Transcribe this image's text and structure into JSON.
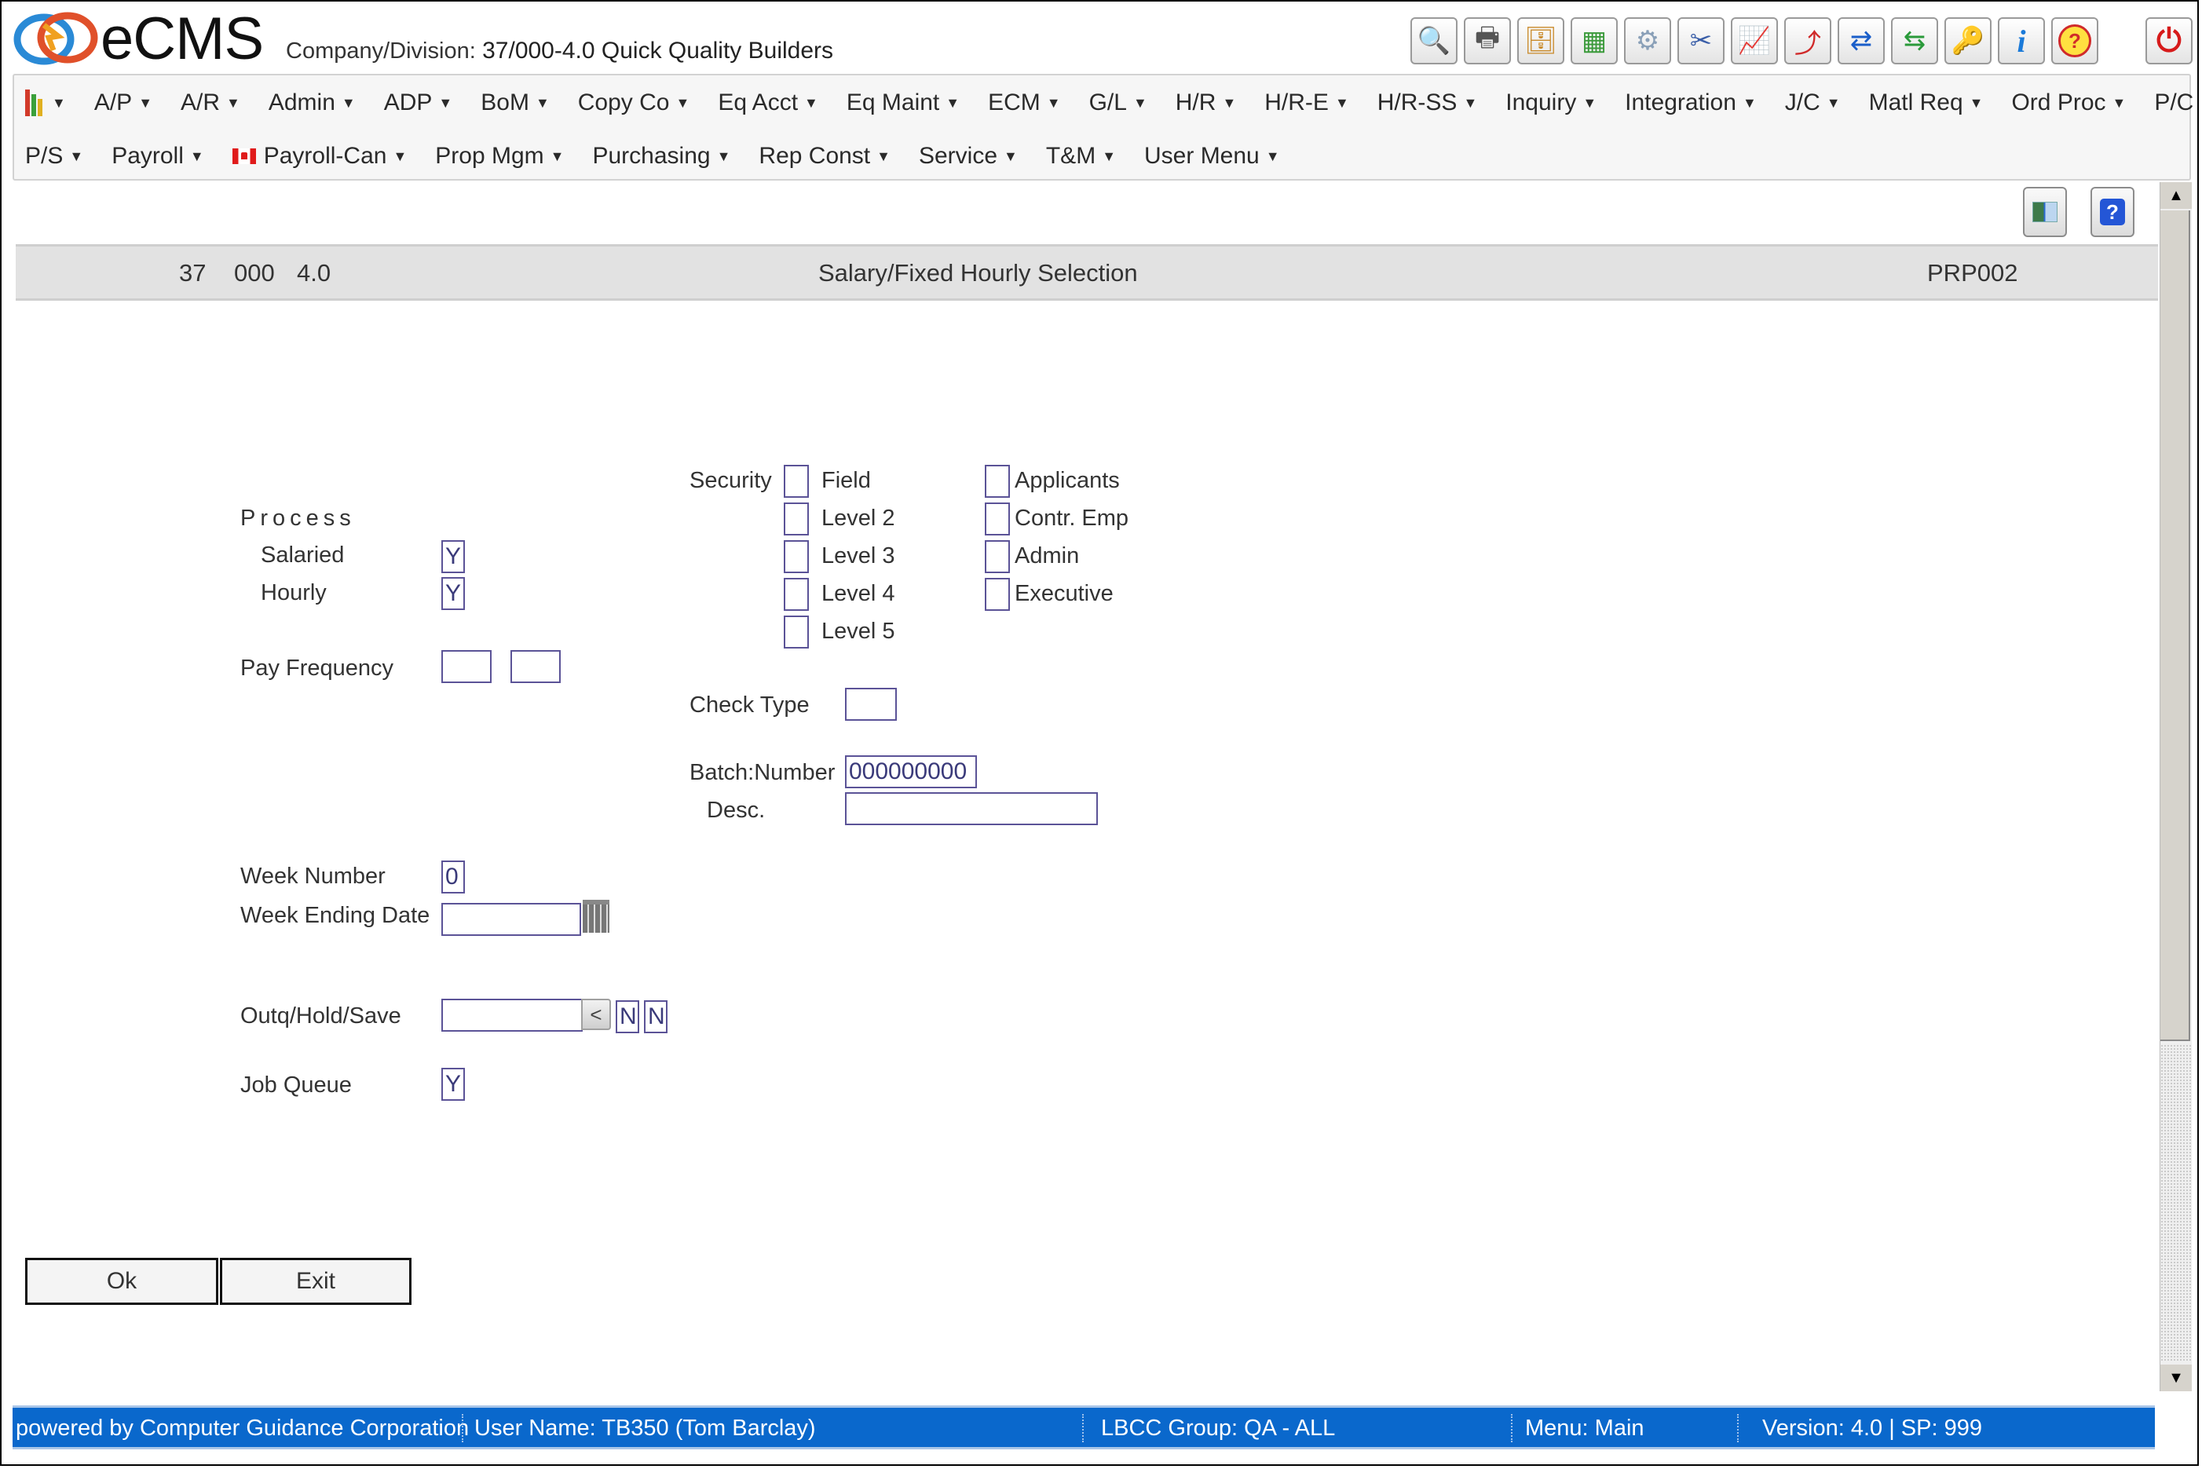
{
  "app": {
    "brand": "eCMS",
    "company_label": "Company/Division:",
    "company_value": "37/000-4.0 Quick Quality Builders"
  },
  "toolbar": {
    "icons": [
      {
        "name": "web-search-icon",
        "glyph": "🔍",
        "color": "#1a6fc9"
      },
      {
        "name": "printer-icon",
        "glyph": "🖶",
        "color": "#555555"
      },
      {
        "name": "file-cabinet-icon",
        "glyph": "🗄",
        "color": "#c98a2a"
      },
      {
        "name": "spreadsheet-icon",
        "glyph": "▦",
        "color": "#3a9a3a"
      },
      {
        "name": "gear-icon",
        "glyph": "⚙",
        "color": "#8aa0b8"
      },
      {
        "name": "tools-icon",
        "glyph": "✂",
        "color": "#3a5ea8"
      },
      {
        "name": "trend-up-icon",
        "glyph": "📈",
        "color": "#d02a2a"
      },
      {
        "name": "trend-compare-icon",
        "glyph": "⤴",
        "color": "#d02a2a"
      },
      {
        "name": "refresh-icon",
        "glyph": "⇄",
        "color": "#1a5ec9"
      },
      {
        "name": "window-transfer-icon",
        "glyph": "⇆",
        "color": "#2a9a3a"
      },
      {
        "name": "keys-icon",
        "glyph": "🔑",
        "color": "#c99a2a"
      },
      {
        "name": "info-icon",
        "glyph": "i",
        "color": "#1a7ad9"
      },
      {
        "name": "help-icon",
        "glyph": "?",
        "color": "#d02a2a"
      }
    ],
    "power": {
      "name": "power-icon",
      "glyph": "⏻",
      "color": "#d61a1a"
    }
  },
  "menu": {
    "row1": [
      "A/P",
      "A/R",
      "Admin",
      "ADP",
      "BoM",
      "Copy Co",
      "Eq Acct",
      "Eq Maint",
      "ECM",
      "G/L",
      "H/R",
      "H/R-E",
      "H/R-SS",
      "Inquiry",
      "Integration",
      "J/C",
      "Matl Req",
      "Ord Proc",
      "P/C"
    ],
    "row2_start": [
      "P/S",
      "Payroll"
    ],
    "payroll_can": "Payroll-Can",
    "row2_end": [
      "Prop Mgm",
      "Purchasing",
      "Rep Const",
      "Service",
      "T&M",
      "User Menu"
    ],
    "arrow": "▼"
  },
  "page": {
    "company": "37",
    "division": "000",
    "version": "4.0",
    "title": "Salary/Fixed Hourly Selection",
    "program": "PRP002"
  },
  "form": {
    "process_label": "Process",
    "salaried": {
      "label": "Salaried",
      "value": "Y"
    },
    "hourly": {
      "label": "Hourly",
      "value": "Y"
    },
    "pay_frequency": {
      "label": "Pay Frequency",
      "value1": "",
      "value2": ""
    },
    "security": {
      "label": "Security",
      "col1": [
        {
          "label": "Field",
          "checked": false
        },
        {
          "label": "Level 2",
          "checked": false
        },
        {
          "label": "Level 3",
          "checked": false
        },
        {
          "label": "Level 4",
          "checked": false
        },
        {
          "label": "Level 5",
          "checked": false
        }
      ],
      "col2": [
        {
          "label": "Applicants",
          "checked": false
        },
        {
          "label": "Contr. Emp",
          "checked": false
        },
        {
          "label": "Admin",
          "checked": false
        },
        {
          "label": "Executive",
          "checked": false
        }
      ]
    },
    "check_type": {
      "label": "Check Type",
      "value": ""
    },
    "batch_number": {
      "label": "Batch:Number",
      "value": "000000000"
    },
    "desc": {
      "label": "Desc.",
      "value": ""
    },
    "week_number": {
      "label": "Week Number",
      "value": "0"
    },
    "week_ending_date": {
      "label": "Week Ending Date",
      "value": ""
    },
    "outq": {
      "label": "Outq/Hold/Save",
      "value": "",
      "hold": "N",
      "save": "N",
      "button_glyph": "<"
    },
    "job_queue": {
      "label": "Job Queue",
      "value": "Y"
    }
  },
  "buttons": {
    "ok": "Ok",
    "exit": "Exit"
  },
  "status_bar": {
    "powered_by": "powered by Computer Guidance Corporation",
    "user": "User Name:  TB350 (Tom Barclay)",
    "group": "LBCC Group:  QA - ALL",
    "menu": "Menu:  Main",
    "version": "Version: 4.0 | SP: 999"
  },
  "colors": {
    "status_bar": "#0a68cc",
    "field_border": "#5b5397",
    "title_bar": "#e2e2e2"
  }
}
